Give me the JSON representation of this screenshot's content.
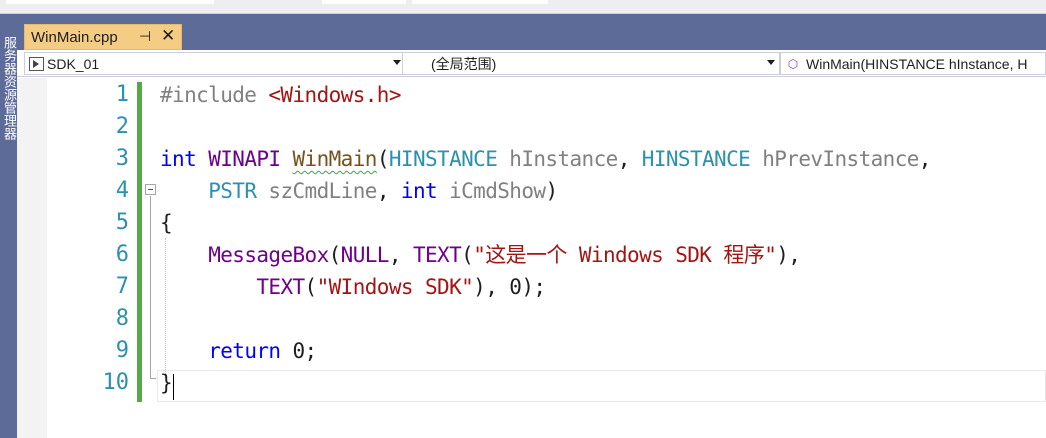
{
  "side_panel": {
    "label": "服务器资源管理器"
  },
  "tab": {
    "title": "WinMain.cpp",
    "pin_glyph": "⊣",
    "close_glyph": "✕"
  },
  "nav": {
    "project": "SDK_01",
    "scope": "(全局范围)",
    "member": "WinMain(HINSTANCE hInstance, H"
  },
  "editor": {
    "line_numbers": [
      "1",
      "2",
      "3",
      "4",
      "5",
      "6",
      "7",
      "8",
      "9",
      "10"
    ],
    "lines": [
      [
        {
          "t": "#include ",
          "c": "pp"
        },
        {
          "t": "<Windows.h>",
          "c": "str"
        }
      ],
      [],
      [
        {
          "t": "int",
          "c": "kw"
        },
        {
          "t": " ",
          "c": ""
        },
        {
          "t": "WINAPI",
          "c": "mac"
        },
        {
          "t": " ",
          "c": ""
        },
        {
          "t": "WinMain",
          "c": "fn squig"
        },
        {
          "t": "(",
          "c": ""
        },
        {
          "t": "HINSTANCE",
          "c": "typ"
        },
        {
          "t": " ",
          "c": ""
        },
        {
          "t": "hInstance",
          "c": "par"
        },
        {
          "t": ", ",
          "c": ""
        },
        {
          "t": "HINSTANCE",
          "c": "typ"
        },
        {
          "t": " ",
          "c": ""
        },
        {
          "t": "hPrevInstance",
          "c": "par"
        },
        {
          "t": ",",
          "c": ""
        }
      ],
      [
        {
          "t": "    ",
          "c": ""
        },
        {
          "t": "PSTR",
          "c": "typ"
        },
        {
          "t": " ",
          "c": ""
        },
        {
          "t": "szCmdLine",
          "c": "par"
        },
        {
          "t": ", ",
          "c": ""
        },
        {
          "t": "int",
          "c": "kw"
        },
        {
          "t": " ",
          "c": ""
        },
        {
          "t": "iCmdShow",
          "c": "par"
        },
        {
          "t": ")",
          "c": ""
        }
      ],
      [
        {
          "t": "{",
          "c": ""
        }
      ],
      [
        {
          "t": "    ",
          "c": ""
        },
        {
          "t": "MessageBox",
          "c": "mac"
        },
        {
          "t": "(",
          "c": ""
        },
        {
          "t": "NULL",
          "c": "mac"
        },
        {
          "t": ", ",
          "c": ""
        },
        {
          "t": "TEXT",
          "c": "mac"
        },
        {
          "t": "(",
          "c": ""
        },
        {
          "t": "\"这是一个 Windows SDK 程序\"",
          "c": "str"
        },
        {
          "t": "),",
          "c": ""
        }
      ],
      [
        {
          "t": "        ",
          "c": ""
        },
        {
          "t": "TEXT",
          "c": "mac"
        },
        {
          "t": "(",
          "c": ""
        },
        {
          "t": "\"WIndows SDK\"",
          "c": "str"
        },
        {
          "t": "), 0);",
          "c": ""
        }
      ],
      [],
      [
        {
          "t": "    ",
          "c": ""
        },
        {
          "t": "return",
          "c": "kw"
        },
        {
          "t": " 0;",
          "c": ""
        }
      ],
      [
        {
          "t": "}",
          "c": ""
        }
      ]
    ]
  }
}
